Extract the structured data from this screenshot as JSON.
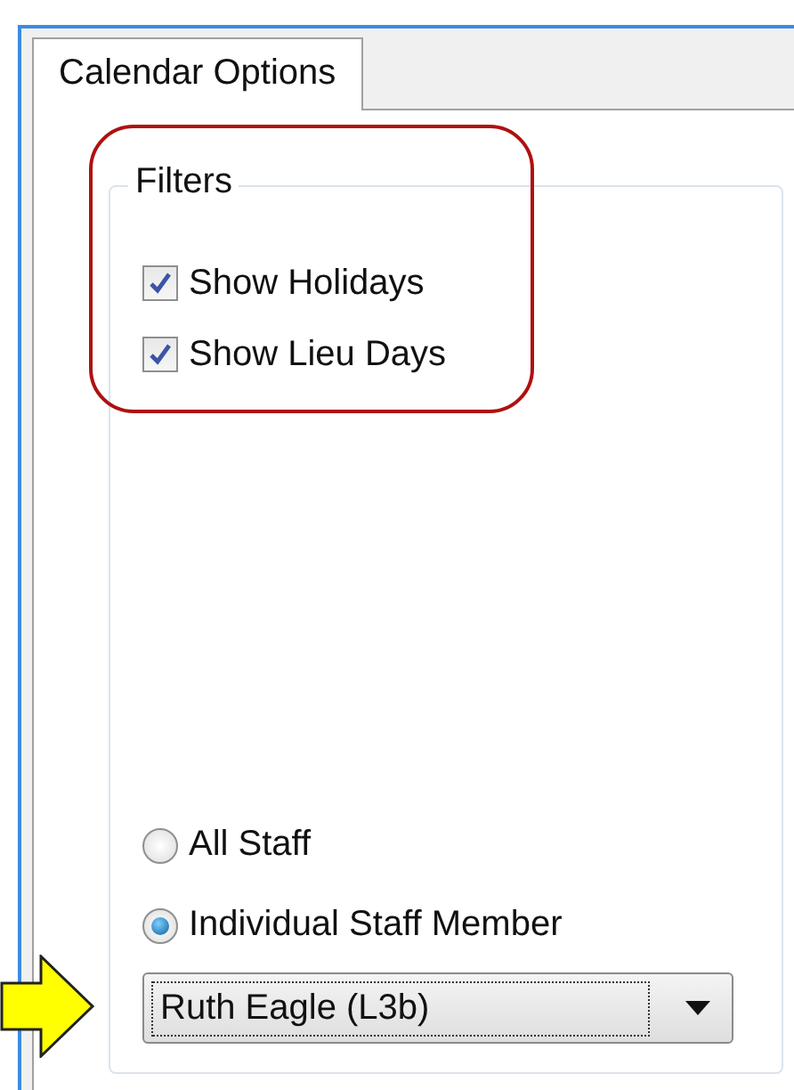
{
  "tabs": [
    {
      "label": "Calendar Options",
      "selected": true
    }
  ],
  "filters": {
    "title": "Filters",
    "checkboxes": [
      {
        "label": "Show Holidays",
        "checked": true
      },
      {
        "label": "Show Lieu Days",
        "checked": true
      }
    ]
  },
  "staff": {
    "radios": [
      {
        "label": "All Staff",
        "selected": false
      },
      {
        "label": "Individual Staff Member",
        "selected": true
      }
    ],
    "dropdown": {
      "value": "Ruth Eagle (L3b)"
    }
  }
}
